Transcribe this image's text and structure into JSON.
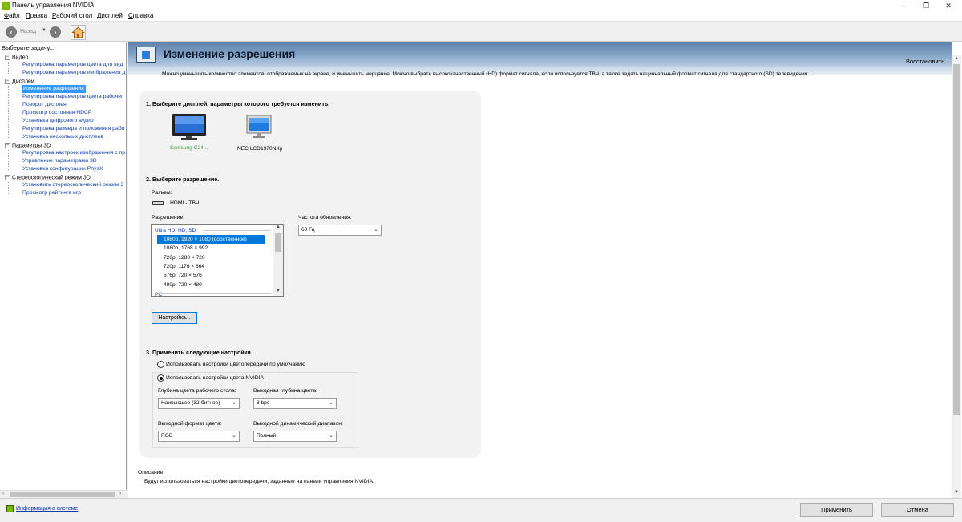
{
  "window": {
    "title": "Панель управления NVIDIA",
    "controls": {
      "minimize": "–",
      "maximize": "❐",
      "close": "✕"
    }
  },
  "menu": [
    {
      "label": "Файл",
      "underline": "Ф",
      "rest": "айл"
    },
    {
      "label": "Правка",
      "underline": "П",
      "rest": "равка"
    },
    {
      "label": "Рабочий стол",
      "underline": "Р",
      "rest": "абочий стол"
    },
    {
      "label": "Дисплей",
      "underline": "Д",
      "rest": "исплей"
    },
    {
      "label": "Справка",
      "underline": "С",
      "rest": "правка"
    }
  ],
  "toolbar": {
    "back_label": "Назад",
    "back_icon": "arrow-left-icon",
    "forward_icon": "arrow-right-icon",
    "home_icon": "home-icon"
  },
  "sidebar": {
    "header": "Выберите задачу...",
    "categories": [
      {
        "label": "Видео",
        "items": [
          "Регулировка параметров цвета для вид",
          "Регулировка параметров изображения д"
        ]
      },
      {
        "label": "Дисплей",
        "items": [
          "Изменение разрешения",
          "Регулировка параметров цвета рабочег",
          "Поворот дисплея",
          "Просмотр состояния HDCP",
          "Установка цифрового аудио",
          "Регулировка размера и положения рабо",
          "Установка нескольких дисплеев"
        ]
      },
      {
        "label": "Параметры 3D",
        "items": [
          "Регулировка настроек изображения с пр",
          "Управление параметрами 3D",
          "Установка конфигурации PhysX"
        ]
      },
      {
        "label": "Стереоскопический режим 3D",
        "items": [
          "Установить стереоскопический режим 3",
          "Просмотр рейтинга игр"
        ]
      }
    ],
    "selected": "Изменение разрешения"
  },
  "main": {
    "title": "Изменение разрешения",
    "restore": "Восстановить",
    "description": "Можно уменьшить количество элементов, отображаемых на экране, и уменьшить мерцание. Можно выбрать высококачественный (HD) формат сигнала, если используется ТВЧ, а также задать национальный формат сигнала для стандартного (SD) телевидения.",
    "step1": {
      "title": "1. Выберите дисплей, параметры которого требуется изменить.",
      "displays": [
        {
          "label": "Samsung C24...",
          "selected": true
        },
        {
          "label": "NEC LCD1970NXp",
          "selected": false
        }
      ]
    },
    "step2": {
      "title": "2. Выберите разрешение.",
      "connector_label": "Разъем:",
      "connector_value": "HDMI - ТВЧ",
      "resolution_label": "Разрешение:",
      "refresh_label": "Частота обновления:",
      "refresh_value": "60 Гц",
      "resolution_group": "Ultra HD, HD, SD",
      "resolutions": [
        "1080p, 1920 × 1080 (собственное)",
        "1080p, 1768 × 992",
        "720p, 1280 × 720",
        "720p, 1176 × 664",
        "576p, 720 × 576",
        "480p, 720 × 480"
      ],
      "next_group": "PC",
      "customize_button": "Настройка..."
    },
    "step3": {
      "title": "3. Применить следующие настройки.",
      "radio_default": "Использовать настройки цветопередачи по умолчанию",
      "radio_nvidia": "Использовать настройки цвета NVIDIA",
      "depth_label": "Глубина цвета рабочего стола:",
      "depth_value": "Наивысшее (32-битное)",
      "output_depth_label": "Выходная глубина цвета:",
      "output_depth_value": "8 bpc",
      "format_label": "Выходной формат цвета:",
      "format_value": "RGB",
      "range_label": "Выходной динамический диапазон:",
      "range_value": "Полный"
    },
    "info_title": "Описание.",
    "info_text": "Будут использоваться настройки цветопередачи, заданные на панели управления NVIDIA."
  },
  "footer": {
    "system_info": "Информация о системе",
    "apply": "Применить",
    "cancel": "Отмена"
  },
  "colors": {
    "accent": "#0078d7",
    "nvidia_green": "#76b900",
    "link": "#0b3ea8",
    "selected_display_label": "#3aa13a"
  }
}
